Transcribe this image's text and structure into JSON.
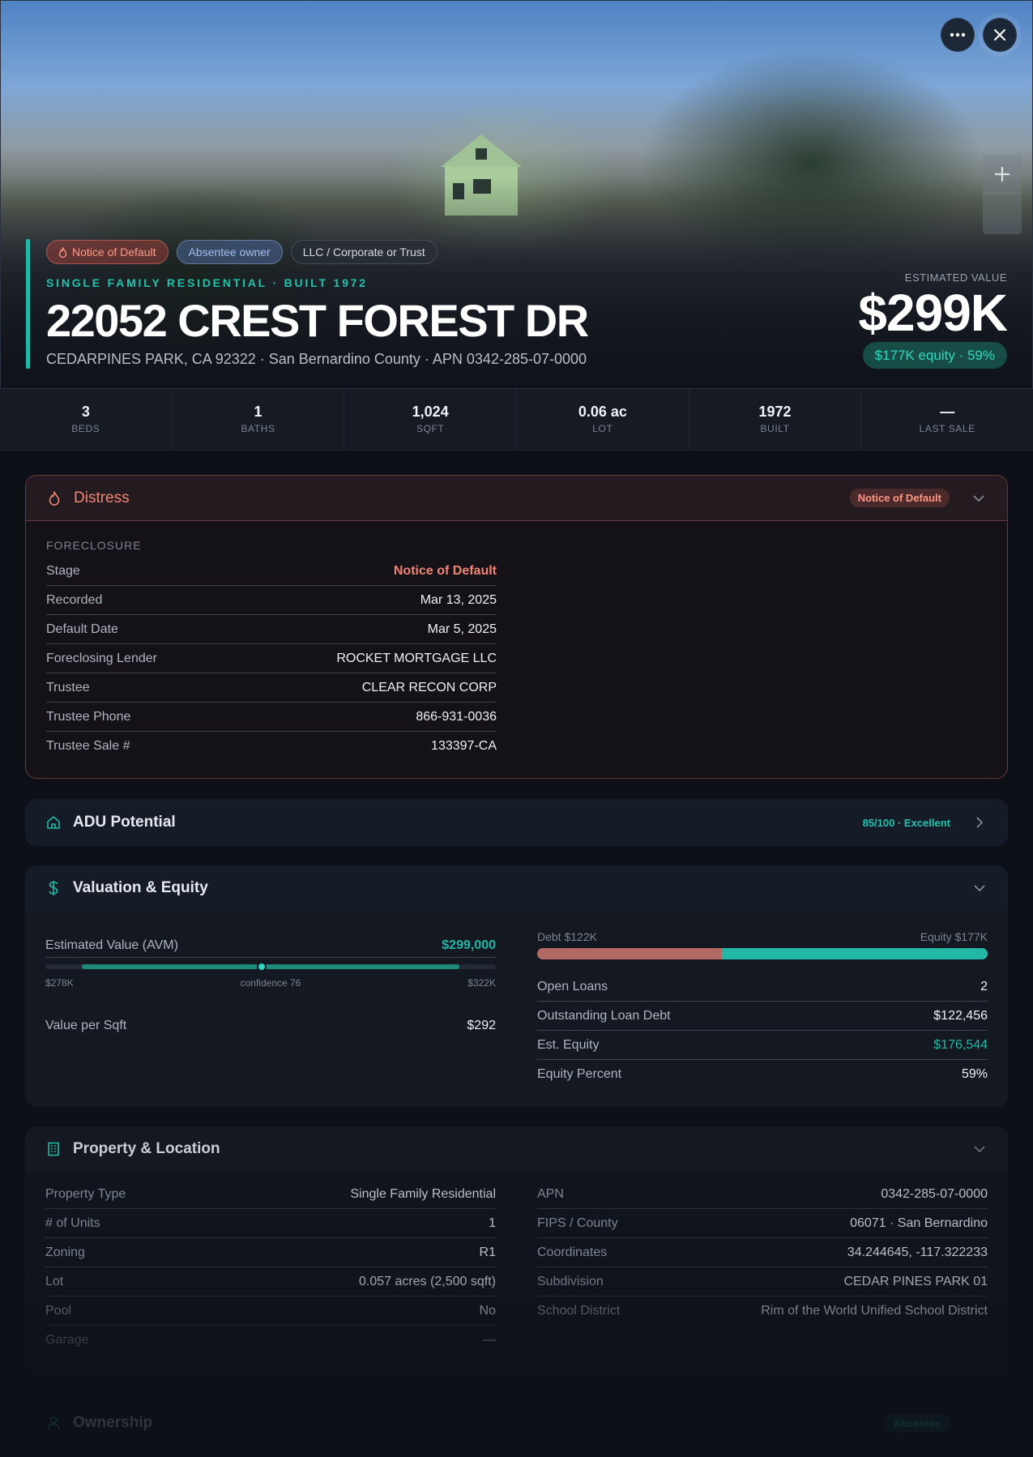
{
  "hero": {
    "chips": [
      "Notice of Default",
      "Absentee owner",
      "LLC / Corporate or Trust"
    ],
    "subtitle": "SINGLE FAMILY RESIDENTIAL · BUILT 1972",
    "address": "22052 CREST FOREST DR",
    "address_line": "CEDARPINES PARK, CA 92322 · San Bernardino County · APN 0342-285-07-0000",
    "estimated_label": "ESTIMATED VALUE",
    "estimated_value": "$299K",
    "equity_pill": "$177K equity · 59%",
    "more_icon": "more-horizontal-icon",
    "close_icon": "close-icon",
    "zoom_in_icon": "plus-icon"
  },
  "stats": [
    {
      "value": "3",
      "label": "BEDS"
    },
    {
      "value": "1",
      "label": "BATHS"
    },
    {
      "value": "1,024",
      "label": "SQFT"
    },
    {
      "value": "0.06 ac",
      "label": "LOT"
    },
    {
      "value": "1972",
      "label": "BUILT"
    },
    {
      "value": "—",
      "label": "LAST SALE"
    }
  ],
  "distress": {
    "title": "Distress",
    "badge": "Notice of Default",
    "section_label": "FORECLOSURE",
    "rows": [
      {
        "k": "Stage",
        "v": "Notice of Default"
      },
      {
        "k": "Recorded",
        "v": "Mar 13, 2025"
      },
      {
        "k": "Default Date",
        "v": "Mar 5, 2025"
      },
      {
        "k": "Foreclosing Lender",
        "v": "ROCKET MORTGAGE LLC"
      },
      {
        "k": "Trustee",
        "v": "CLEAR RECON CORP"
      },
      {
        "k": "Trustee Phone",
        "v": "866-931-0036"
      },
      {
        "k": "Trustee Sale #",
        "v": "133397-CA"
      }
    ]
  },
  "adu": {
    "title": "ADU Potential",
    "badge": "85/100 · Excellent"
  },
  "valuation": {
    "title": "Valuation & Equity",
    "avm_label": "Estimated Value (AVM)",
    "avm_value": "$299,000",
    "range_low": "$278K",
    "range_high": "$322K",
    "confidence": "confidence 76",
    "range_low_value": 278000,
    "range_high_value": 322000,
    "range_point_value": 299000,
    "value_per_sqft_label": "Value per Sqft",
    "value_per_sqft": "$292",
    "debt_label": "Debt $122K",
    "equity_label": "Equity $177K",
    "debt_amount": 122456,
    "equity_amount": 176544,
    "rows": [
      {
        "k": "Open Loans",
        "v": "2"
      },
      {
        "k": "Outstanding Loan Debt",
        "v": "$122,456"
      },
      {
        "k": "Est. Equity",
        "v": "$176,544"
      },
      {
        "k": "Equity Percent",
        "v": "59%"
      }
    ]
  },
  "property": {
    "title": "Property & Location",
    "left": [
      {
        "k": "Property Type",
        "v": "Single Family Residential"
      },
      {
        "k": "# of Units",
        "v": "1"
      },
      {
        "k": "Zoning",
        "v": "R1"
      },
      {
        "k": "Lot",
        "v": "0.057 acres (2,500 sqft)"
      },
      {
        "k": "Pool",
        "v": "No"
      },
      {
        "k": "Garage",
        "v": "—"
      }
    ],
    "right": [
      {
        "k": "APN",
        "v": "0342-285-07-0000"
      },
      {
        "k": "FIPS / County",
        "v": "06071 · San Bernardino"
      },
      {
        "k": "Coordinates",
        "v": "34.244645, -117.322233"
      },
      {
        "k": "Subdivision",
        "v": "CEDAR PINES PARK 01"
      },
      {
        "k": "School District",
        "v": "Rim of the World Unified School District"
      }
    ]
  },
  "ownership": {
    "title": "Ownership",
    "badge": "Absentee"
  },
  "colors": {
    "accent": "#21b8a5",
    "distress": "#f08576",
    "debt": "#b46a64"
  }
}
